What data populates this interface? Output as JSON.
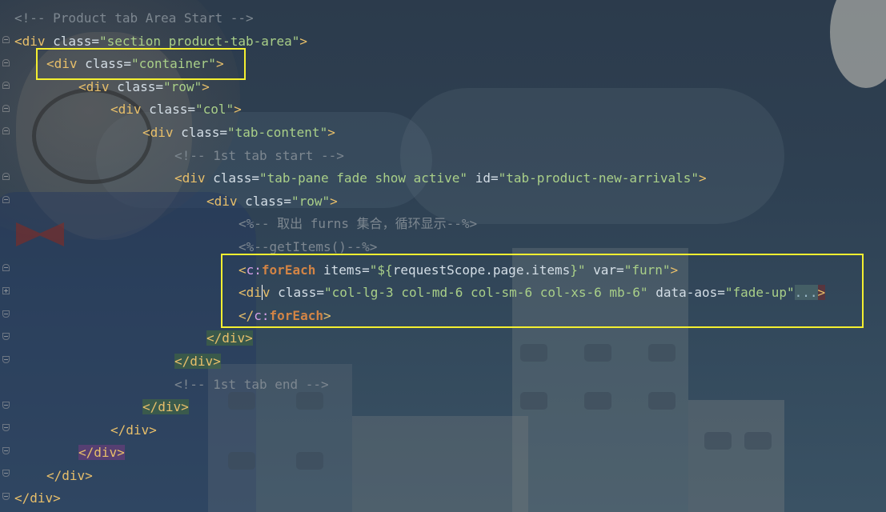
{
  "editor": {
    "lines": [
      {
        "indent": 0,
        "parts": [
          {
            "t": "<!-- Product tab Area Start -->",
            "c": "cmt"
          }
        ]
      },
      {
        "indent": 0,
        "parts": [
          {
            "t": "<div",
            "c": "tag"
          },
          {
            "t": " class=",
            "c": "attr"
          },
          {
            "t": "\"section product-tab-area\"",
            "c": "val"
          },
          {
            "t": ">",
            "c": "tag"
          }
        ]
      },
      {
        "indent": 1,
        "parts": [
          {
            "t": "<div",
            "c": "tag"
          },
          {
            "t": " class=",
            "c": "attr"
          },
          {
            "t": "\"container\"",
            "c": "val"
          },
          {
            "t": ">",
            "c": "tag"
          }
        ]
      },
      {
        "indent": 2,
        "parts": [
          {
            "t": "<div",
            "c": "tag"
          },
          {
            "t": " class=",
            "c": "attr"
          },
          {
            "t": "\"row\"",
            "c": "val"
          },
          {
            "t": ">",
            "c": "tag"
          }
        ]
      },
      {
        "indent": 3,
        "parts": [
          {
            "t": "<div",
            "c": "tag"
          },
          {
            "t": " class=",
            "c": "attr"
          },
          {
            "t": "\"col\"",
            "c": "val"
          },
          {
            "t": ">",
            "c": "tag"
          }
        ]
      },
      {
        "indent": 4,
        "parts": [
          {
            "t": "<div",
            "c": "tag"
          },
          {
            "t": " class=",
            "c": "attr"
          },
          {
            "t": "\"tab-content\"",
            "c": "val"
          },
          {
            "t": ">",
            "c": "tag"
          }
        ]
      },
      {
        "indent": 5,
        "parts": [
          {
            "t": "<!-- 1st tab start -->",
            "c": "cmt"
          }
        ]
      },
      {
        "indent": 5,
        "parts": [
          {
            "t": "<div",
            "c": "tag"
          },
          {
            "t": " class=",
            "c": "attr"
          },
          {
            "t": "\"tab-pane fade show active\"",
            "c": "val"
          },
          {
            "t": " id=",
            "c": "attr"
          },
          {
            "t": "\"tab-product-new-arrivals\"",
            "c": "val"
          },
          {
            "t": ">",
            "c": "tag"
          }
        ]
      },
      {
        "indent": 6,
        "parts": [
          {
            "t": "<div",
            "c": "tag"
          },
          {
            "t": " class=",
            "c": "attr"
          },
          {
            "t": "\"row\"",
            "c": "val"
          },
          {
            "t": ">",
            "c": "tag"
          }
        ]
      },
      {
        "indent": 7,
        "parts": [
          {
            "t": "<%-- 取出 furns 集合，循环显示--%>",
            "c": "cmt"
          }
        ]
      },
      {
        "indent": 7,
        "parts": [
          {
            "t": "<%--getItems()--%>",
            "c": "cmt"
          }
        ]
      },
      {
        "indent": 7,
        "parts": [
          {
            "t": "<",
            "c": "tag"
          },
          {
            "t": "c:",
            "c": "jsp-prefix"
          },
          {
            "t": "forEach",
            "c": "jsp-tag"
          },
          {
            "t": " items=",
            "c": "attr"
          },
          {
            "t": "\"${",
            "c": "val"
          },
          {
            "t": "requestScope.page.items",
            "c": "el"
          },
          {
            "t": "}\"",
            "c": "val"
          },
          {
            "t": " var=",
            "c": "attr"
          },
          {
            "t": "\"furn\"",
            "c": "val"
          },
          {
            "t": ">",
            "c": "tag"
          }
        ]
      },
      {
        "indent": 7,
        "parts": [
          {
            "t": "<di",
            "c": "tag"
          },
          {
            "t": "v",
            "c": "tag caret"
          },
          {
            "t": " class=",
            "c": "attr"
          },
          {
            "t": "\"col-lg-3 col-md-6 col-sm-6 col-xs-6 mb-6\"",
            "c": "val"
          },
          {
            "t": " data-aos=",
            "c": "attr"
          },
          {
            "t": "\"fade-up\"",
            "c": "val"
          },
          {
            "t": "...",
            "c": "dots"
          },
          {
            "t": ">",
            "c": "tag tagbg-r"
          }
        ]
      },
      {
        "indent": 7,
        "parts": [
          {
            "t": "</",
            "c": "tag"
          },
          {
            "t": "c:",
            "c": "jsp-prefix"
          },
          {
            "t": "forEach",
            "c": "jsp-tag"
          },
          {
            "t": ">",
            "c": "tag"
          }
        ]
      },
      {
        "indent": 6,
        "parts": [
          {
            "t": "</div>",
            "c": "tag tagbg-g"
          }
        ]
      },
      {
        "indent": 5,
        "parts": [
          {
            "t": "</div>",
            "c": "tag tagbg-g"
          }
        ]
      },
      {
        "indent": 5,
        "parts": [
          {
            "t": "<!-- 1st tab end -->",
            "c": "cmt"
          }
        ]
      },
      {
        "indent": 4,
        "parts": [
          {
            "t": "</div>",
            "c": "tag tagbg-g"
          }
        ]
      },
      {
        "indent": 3,
        "parts": [
          {
            "t": "</div>",
            "c": "tag"
          }
        ]
      },
      {
        "indent": 2,
        "parts": [
          {
            "t": "</div>",
            "c": "tag tagbg-p"
          }
        ]
      },
      {
        "indent": 1,
        "parts": [
          {
            "t": "</div>",
            "c": "tag"
          }
        ]
      },
      {
        "indent": 0,
        "parts": [
          {
            "t": "</div>",
            "c": "tag"
          }
        ]
      }
    ]
  },
  "colors": {
    "highlight_box": "#f4ef30",
    "comment": "#7d8790",
    "tag": "#e8bf6a",
    "string": "#a9cf88",
    "jsp_tag": "#d28445"
  }
}
